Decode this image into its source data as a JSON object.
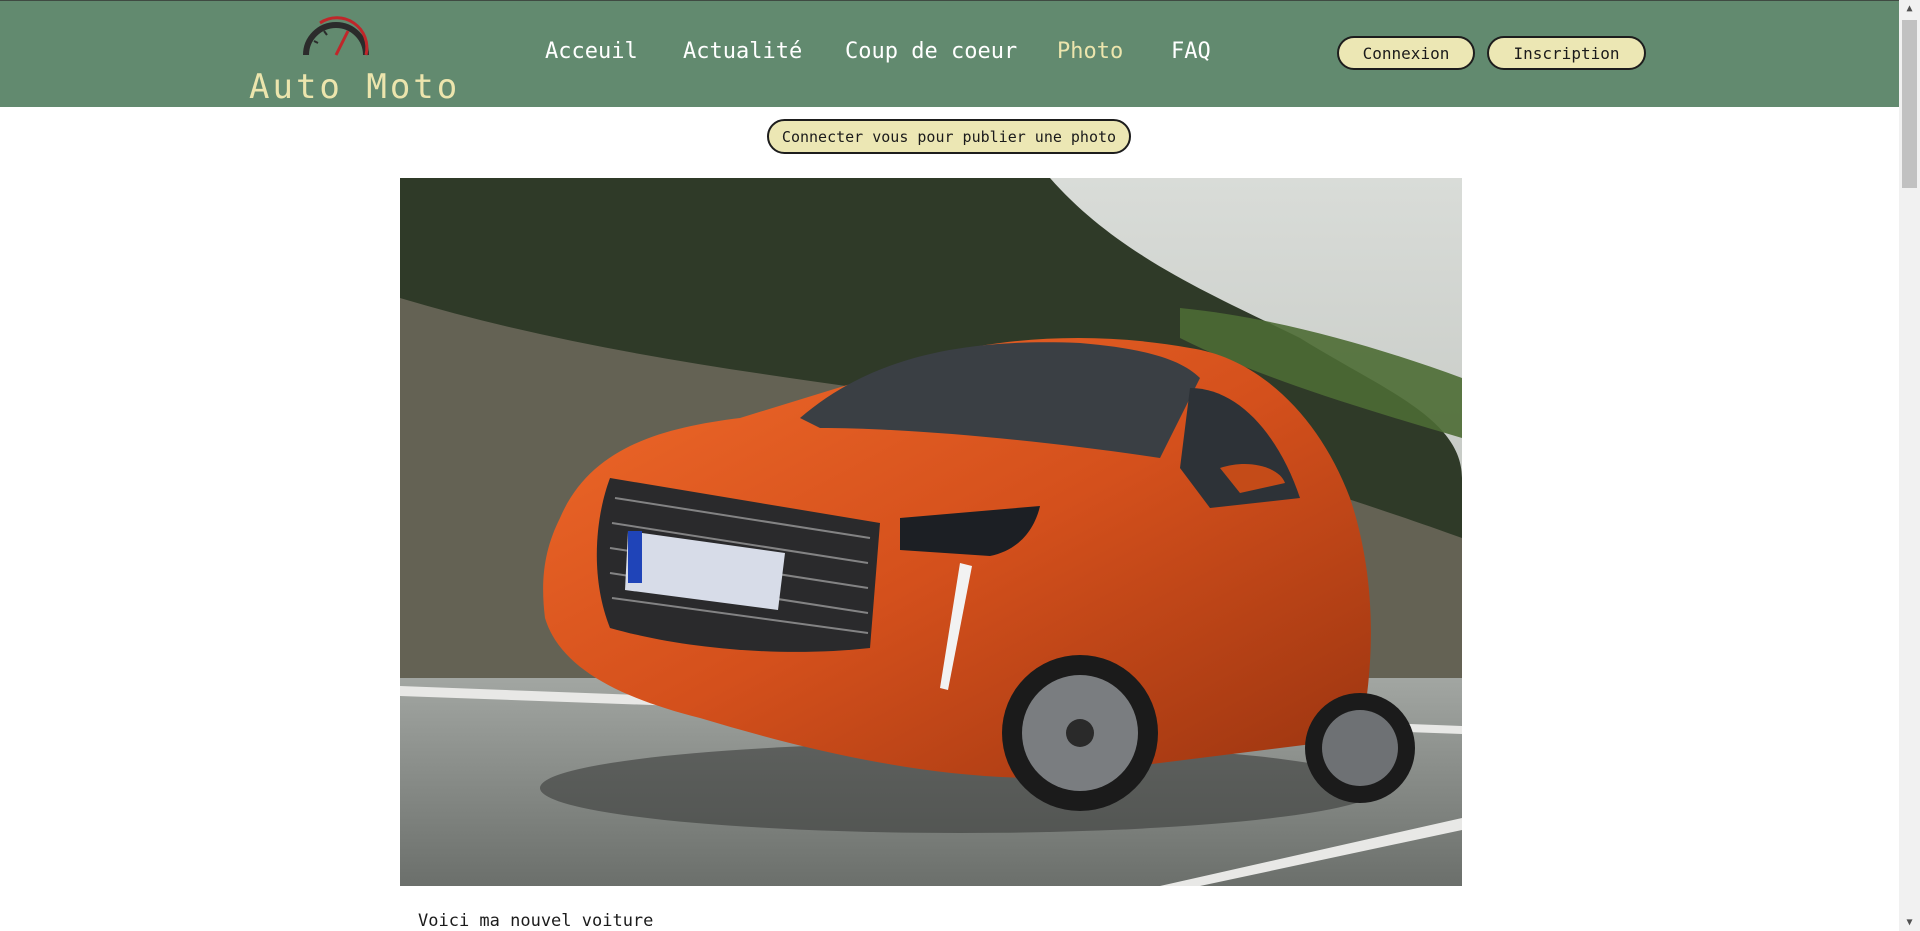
{
  "brand": {
    "logo_text": "Auto Moto",
    "accent_color": "#ece5ad",
    "header_color": "#628a6f"
  },
  "nav": {
    "items": [
      {
        "label": "Acceuil"
      },
      {
        "label": "Actualité"
      },
      {
        "label": "Coup de coeur"
      },
      {
        "label": "Photo",
        "active": true
      },
      {
        "label": "FAQ"
      }
    ]
  },
  "auth": {
    "login_label": "Connexion",
    "signup_label": "Inscription"
  },
  "publish": {
    "label": "Connecter vous pour publier une photo"
  },
  "post": {
    "image_icon": "orange-car-photo",
    "caption": "Voici ma nouvel voiture"
  },
  "scrollbar": {
    "up_icon": "▲",
    "down_icon": "▼"
  }
}
